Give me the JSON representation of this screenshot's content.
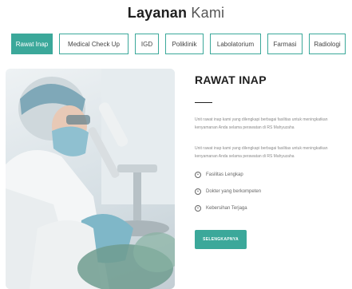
{
  "header": {
    "title_bold": "Layanan",
    "title_light": "Kami"
  },
  "tabs": [
    {
      "label": "Rawat Inap",
      "active": true
    },
    {
      "label": "Medical Check Up",
      "active": false
    },
    {
      "label": "IGD",
      "active": false
    },
    {
      "label": "Poliklinik",
      "active": false
    },
    {
      "label": "Labolatorium",
      "active": false
    },
    {
      "label": "Farmasi",
      "active": false
    },
    {
      "label": "Radiologi",
      "active": false
    }
  ],
  "section": {
    "heading": "RAWAT INAP",
    "paragraph1": "Unit rawat inap kami yang dilengkapi berbagai fasilitas untuk meningkatkan kenyamanan Anda selama perawatan di RS Mahyuzaha",
    "paragraph2": "Unit rawat inap kami yang dilengkapi berbagai fasilitas untuk meningkatkan kenyamanan Anda selama perawatan di RS Mahyuzaha",
    "features": [
      "Fasilitas Lengkap",
      "Dokter yang berkompeten",
      "Kebersihan Terjaga"
    ],
    "button_label": "SELENGKAPNYA"
  },
  "colors": {
    "accent": "#3ba89a"
  },
  "icons": {
    "feature": "plus-circle-icon"
  }
}
